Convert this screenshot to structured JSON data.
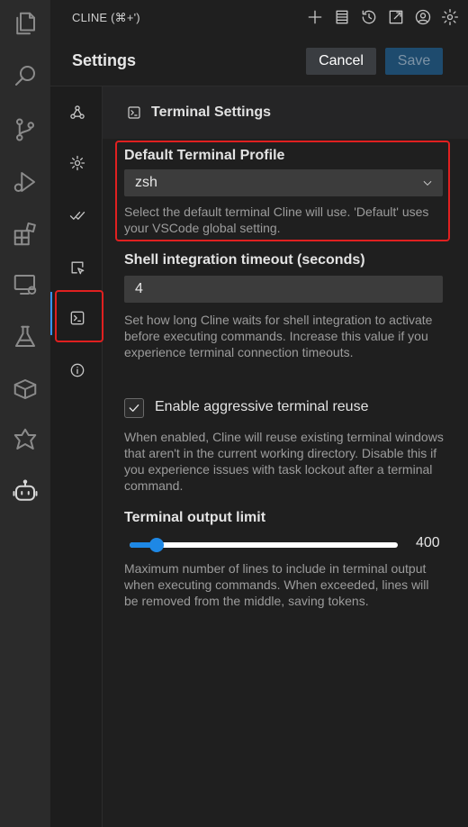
{
  "window": {
    "title": "CLINE (⌘+')"
  },
  "title_actions": [
    "plus-icon",
    "history-list-icon",
    "history-clock-icon",
    "open-external-icon",
    "account-icon",
    "settings-gear-icon"
  ],
  "settings": {
    "title": "Settings",
    "cancel_label": "Cancel",
    "save_label": "Save"
  },
  "tabs": [
    "api-config-icon",
    "general-gear-icon",
    "features-check-icon",
    "browser-cursor-icon",
    "terminal-icon",
    "about-info-icon"
  ],
  "active_tab": "terminal",
  "section": {
    "title": "Terminal Settings"
  },
  "default_profile": {
    "label": "Default Terminal Profile",
    "selected": "zsh",
    "description": "Select the default terminal Cline will use. 'Default' uses your VSCode global setting."
  },
  "shell_timeout": {
    "label": "Shell integration timeout (seconds)",
    "value": "4",
    "description": "Set how long Cline waits for shell integration to activate before executing commands. Increase this value if you experience terminal connection timeouts."
  },
  "aggressive_reuse": {
    "label": "Enable aggressive terminal reuse",
    "checked": true,
    "description": "When enabled, Cline will reuse existing terminal windows that aren't in the current working directory. Disable this if you experience issues with task lockout after a terminal command."
  },
  "output_limit": {
    "label": "Terminal output limit",
    "value": "400",
    "fraction": 0.1,
    "description": "Maximum number of lines to include in terminal output when executing commands. When exceeded, lines will be removed from the middle, saving tokens."
  },
  "colors": {
    "accent": "#1e88e5",
    "highlight": "#e02020",
    "save_button": "#1e4b6e",
    "cancel_button": "#3a3d41"
  }
}
